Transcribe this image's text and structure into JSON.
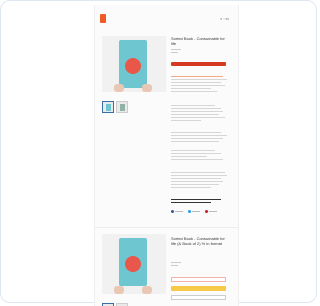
{
  "header": {
    "brand": "",
    "subtitle": "",
    "icons": [
      "search-icon",
      "account-icon",
      "cart-icon"
    ]
  },
  "products": [
    {
      "title": "Sorted Book - Consumable for life",
      "book_cover_title": "",
      "has_red_button": true
    },
    {
      "title": "Sorted Book - Consumable for life (& Book of 2) % in format",
      "book_cover_title": "",
      "has_yellow_button": true
    }
  ],
  "colors": {
    "brand": "#f05a28",
    "red_button": "#d43a1f",
    "yellow_button": "#f7c948",
    "book": "#6ec7d0"
  }
}
